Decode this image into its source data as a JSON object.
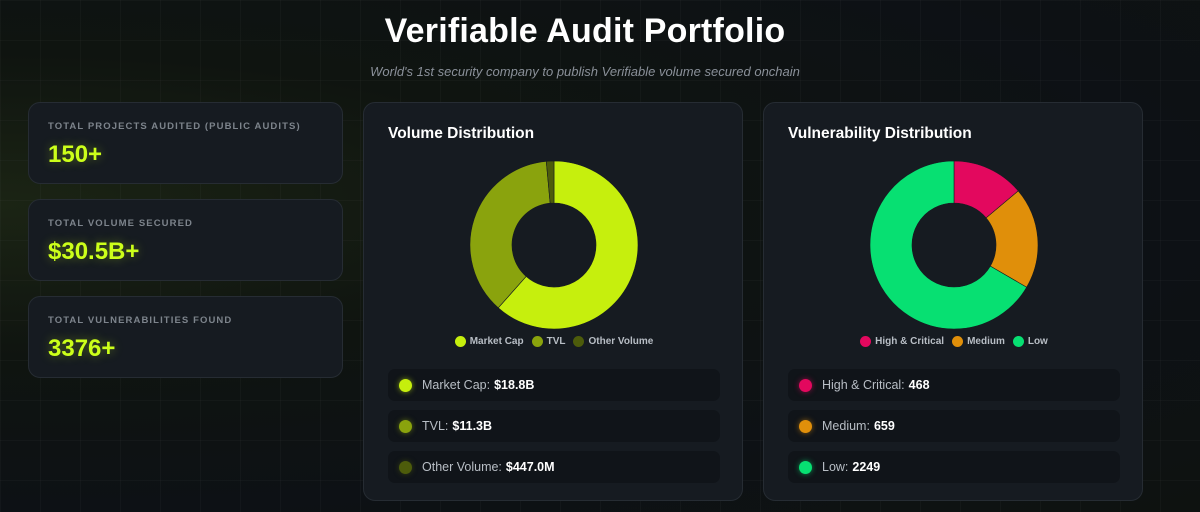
{
  "header": {
    "title": "Verifiable Audit Portfolio",
    "subtitle": "World's 1st security company to publish Verifiable volume secured onchain"
  },
  "stats": [
    {
      "label": "TOTAL PROJECTS AUDITED (PUBLIC AUDITS)",
      "value": "150+"
    },
    {
      "label": "TOTAL VOLUME SECURED",
      "value": "$30.5B+"
    },
    {
      "label": "TOTAL VULNERABILITIES FOUND",
      "value": "3376+"
    }
  ],
  "volume": {
    "title": "Volume Distribution",
    "legend": [
      "Market Cap",
      "TVL",
      "Other Volume"
    ],
    "rows": [
      {
        "label": "Market Cap:",
        "value": "$18.8B"
      },
      {
        "label": "TVL:",
        "value": "$11.3B"
      },
      {
        "label": "Other Volume:",
        "value": "$447.0M"
      }
    ]
  },
  "vulnerability": {
    "title": "Vulnerability Distribution",
    "legend": [
      "High & Critical",
      "Medium",
      "Low"
    ],
    "rows": [
      {
        "label": "High & Critical:",
        "value": "468"
      },
      {
        "label": "Medium:",
        "value": "659"
      },
      {
        "label": "Low:",
        "value": "2249"
      }
    ]
  },
  "chart_data": [
    {
      "type": "pie",
      "title": "Volume Distribution",
      "categories": [
        "Market Cap",
        "TVL",
        "Other Volume"
      ],
      "values": [
        18.8,
        11.3,
        0.447
      ],
      "colors": [
        "#c6ef0d",
        "#8aa30d",
        "#4d5c0b"
      ],
      "legend": "bottom"
    },
    {
      "type": "pie",
      "title": "Vulnerability Distribution",
      "categories": [
        "High & Critical",
        "Medium",
        "Low"
      ],
      "values": [
        468,
        659,
        2249
      ],
      "colors": [
        "#e3085e",
        "#e08f0a",
        "#07e072"
      ],
      "legend": "bottom"
    }
  ],
  "colors": {
    "accent": "#ccff1a",
    "background": "#0d1115",
    "card": "#161b21"
  }
}
